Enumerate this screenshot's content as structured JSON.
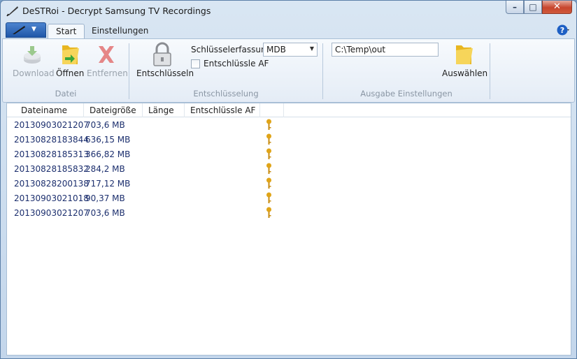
{
  "window": {
    "title": "DeSTRoi - Decrypt Samsung TV Recordings"
  },
  "tabs": [
    {
      "label": "Start"
    },
    {
      "label": "Einstellungen"
    }
  ],
  "ribbon": {
    "datei": {
      "label": "Datei",
      "download_label": "Download",
      "open_label": "Öffnen",
      "remove_label": "Entfernen"
    },
    "entschluesselung": {
      "label": "Entschlüsselung",
      "decrypt_label": "Entschlüsseln",
      "key_capture_label": "Schlüsselerfassung",
      "key_capture_value": "MDB",
      "decrypt_af_label": "Entschlüssle AF"
    },
    "ausgabe": {
      "label": "Ausgabe Einstellungen",
      "path_value": "C:\\Temp\\out",
      "choose_label": "Auswählen"
    }
  },
  "list": {
    "columns": [
      "Dateiname",
      "Dateigröße",
      "Länge",
      "Entschlüssle AF"
    ],
    "rows": [
      {
        "name": "20130903021207",
        "size": "703,6 MB"
      },
      {
        "name": "20130828183844",
        "size": "636,15 MB"
      },
      {
        "name": "20130828185313",
        "size": "366,82 MB"
      },
      {
        "name": "20130828185832",
        "size": "284,2 MB"
      },
      {
        "name": "20130828200138",
        "size": "717,12 MB"
      },
      {
        "name": "20130903021018",
        "size": "90,37 MB"
      },
      {
        "name": "20130903021207",
        "size": "703,6 MB"
      }
    ]
  },
  "colors": {
    "accent": "#1f57a8",
    "list_text": "#1c2f6e",
    "key": "#e0a418"
  }
}
